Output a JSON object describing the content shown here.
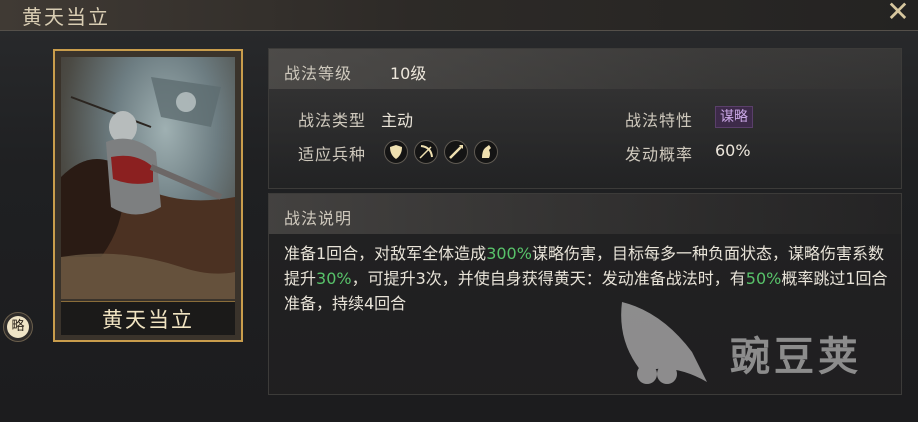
{
  "window": {
    "title": "黄天当立",
    "close_icon": "close-icon"
  },
  "card": {
    "name": "黄天当立",
    "badge_label": "略",
    "frame_color": "#c99d4c"
  },
  "stats": {
    "level_label": "战法等级",
    "level_value": "10级",
    "type_label": "战法类型",
    "type_value": "主动",
    "trait_label": "战法特性",
    "trait_value": "谋略",
    "troops_label": "适应兵种",
    "troop_icons": [
      "shield-troop-icon",
      "bow-troop-icon",
      "spear-troop-icon",
      "horse-troop-icon"
    ],
    "chance_label": "发动概率",
    "chance_value": "60%"
  },
  "description": {
    "heading": "战法说明",
    "segments": [
      {
        "text": "准备1回合，对敌军全体造成",
        "highlight": false
      },
      {
        "text": "300%",
        "highlight": true
      },
      {
        "text": "谋略伤害，目标每多一种负面状态，谋略伤害系数提升",
        "highlight": false
      },
      {
        "text": "30%",
        "highlight": true
      },
      {
        "text": "，可提升3次，并使自身获得黄天：发动准备战法时，有",
        "highlight": false
      },
      {
        "text": "50%",
        "highlight": true
      },
      {
        "text": "概率跳过1回合准备，持续4回合",
        "highlight": false
      }
    ],
    "highlight_color": "#58c26a"
  },
  "watermark": {
    "text": "豌豆荚"
  }
}
